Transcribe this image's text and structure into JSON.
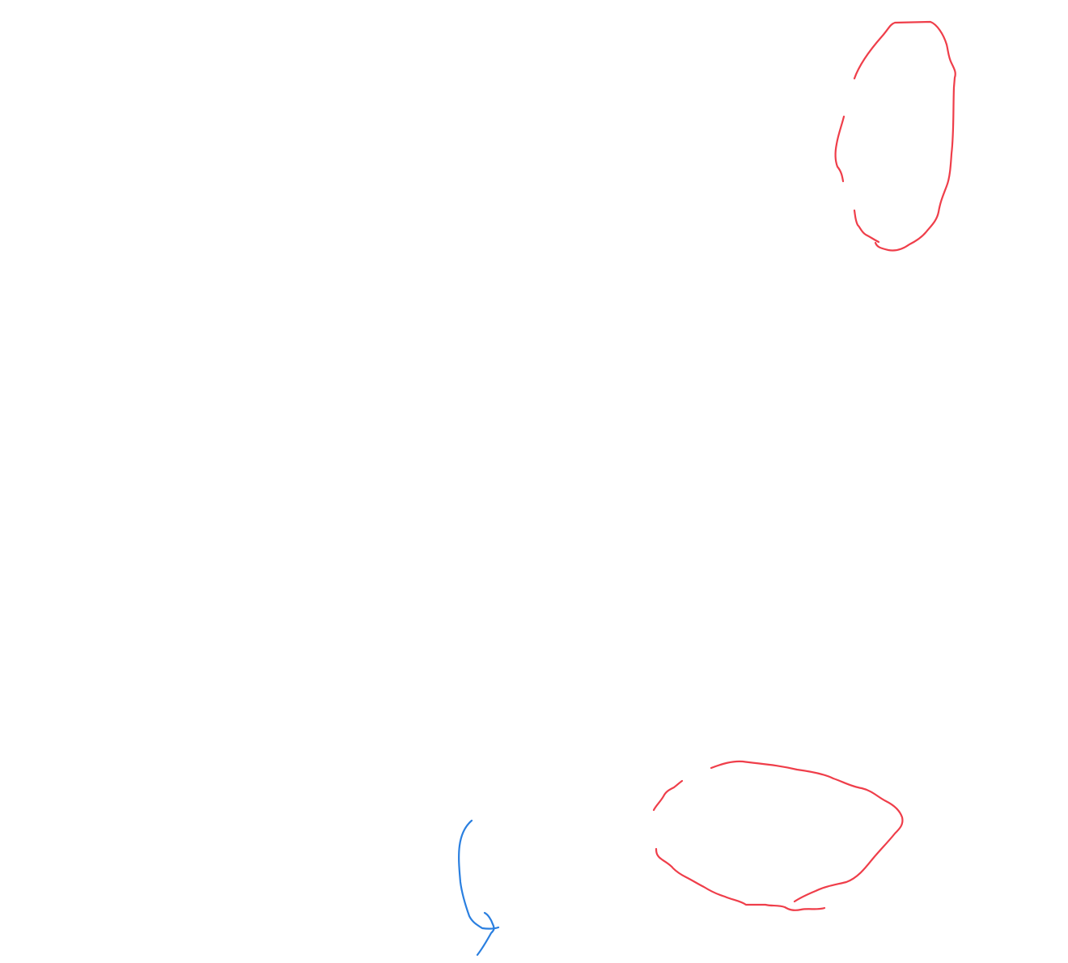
{
  "canvas": {
    "background": "#ffffff"
  },
  "strokes": {
    "annotation_color": "#ef3e4a",
    "arrow_color": "#2a7fe0",
    "items": [
      {
        "name": "red-ellipse-top-right",
        "kind": "freehand-ellipse",
        "color_key": "annotation_color"
      },
      {
        "name": "red-ellipse-bottom",
        "kind": "freehand-ellipse",
        "color_key": "annotation_color"
      },
      {
        "name": "blue-curved-arrow",
        "kind": "freehand-arrow",
        "color_key": "arrow_color"
      }
    ]
  }
}
